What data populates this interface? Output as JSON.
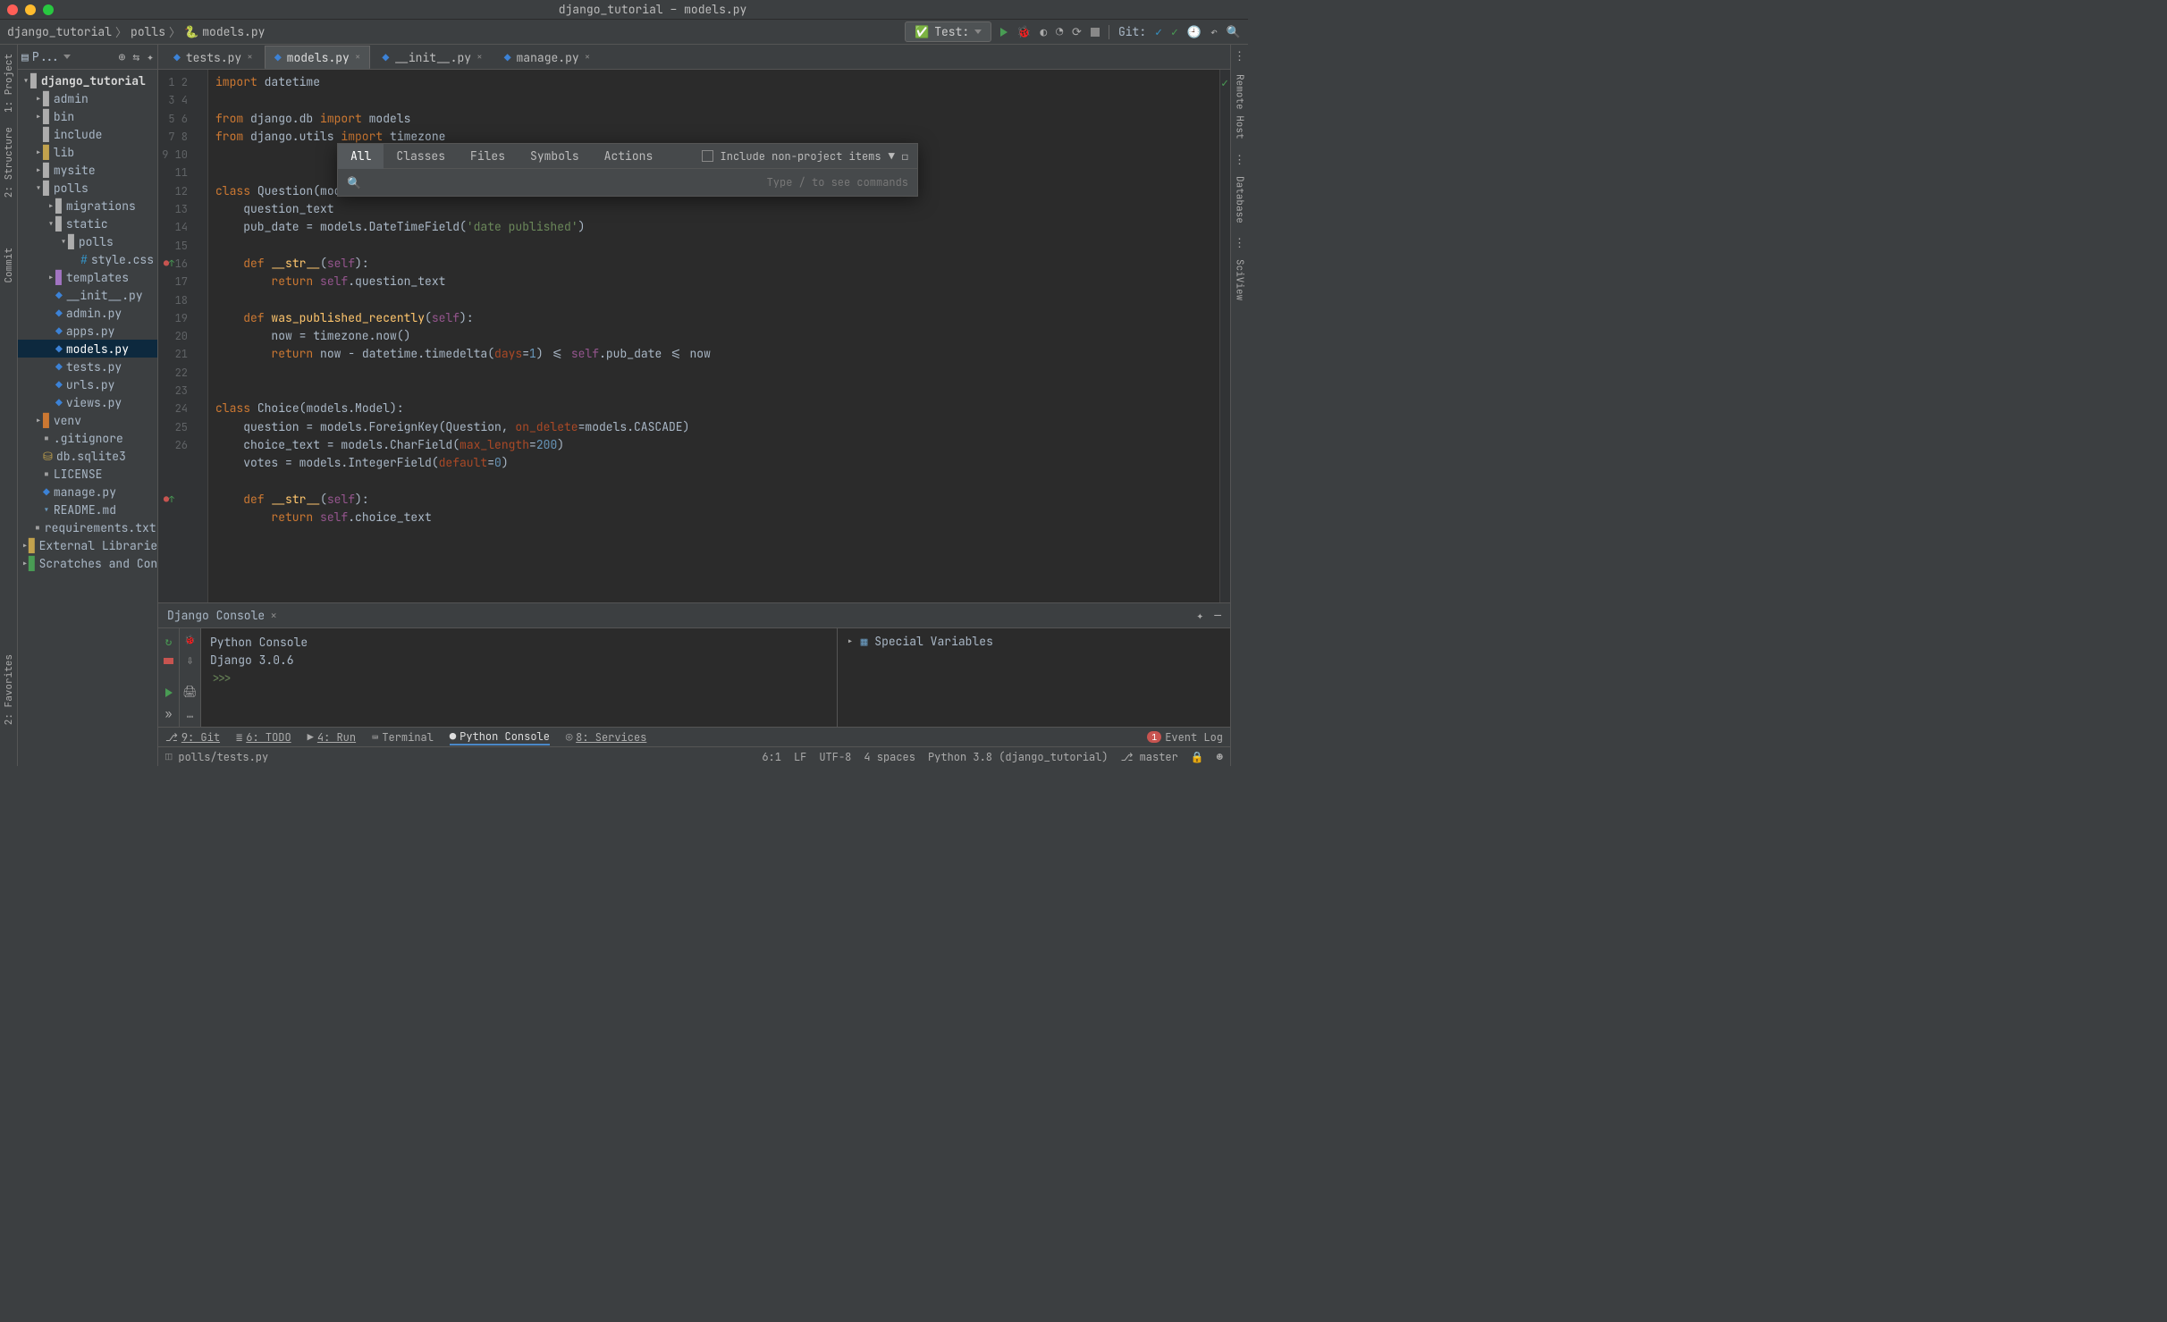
{
  "title": "django_tutorial – models.py",
  "breadcrumb": [
    "django_tutorial",
    "polls",
    "models.py"
  ],
  "run_config": "Test:",
  "git_label": "Git:",
  "left_tabs": [
    "1: Project",
    "2: Structure",
    "Commit",
    "2: Favorites"
  ],
  "right_tabs": [
    "Remote Host",
    "Database",
    "SciView"
  ],
  "project_panel_label": "P...",
  "tree": {
    "root": "django_tutorial",
    "items": [
      {
        "d": 1,
        "t": "f",
        "n": "admin",
        "car": "right"
      },
      {
        "d": 1,
        "t": "f",
        "n": "bin",
        "car": "right"
      },
      {
        "d": 1,
        "t": "f",
        "n": "include",
        "car": "blank"
      },
      {
        "d": 1,
        "t": "fy",
        "n": "lib",
        "car": "right"
      },
      {
        "d": 1,
        "t": "f",
        "n": "mysite",
        "car": "right"
      },
      {
        "d": 1,
        "t": "f",
        "n": "polls",
        "car": "down"
      },
      {
        "d": 2,
        "t": "f",
        "n": "migrations",
        "car": "right"
      },
      {
        "d": 2,
        "t": "f",
        "n": "static",
        "car": "down"
      },
      {
        "d": 3,
        "t": "f",
        "n": "polls",
        "car": "down"
      },
      {
        "d": 4,
        "t": "css",
        "n": "style.css",
        "car": "blank"
      },
      {
        "d": 2,
        "t": "fp",
        "n": "templates",
        "car": "right"
      },
      {
        "d": 2,
        "t": "py",
        "n": "__init__.py",
        "car": "blank"
      },
      {
        "d": 2,
        "t": "py",
        "n": "admin.py",
        "car": "blank"
      },
      {
        "d": 2,
        "t": "py",
        "n": "apps.py",
        "car": "blank"
      },
      {
        "d": 2,
        "t": "py",
        "n": "models.py",
        "car": "blank",
        "sel": true
      },
      {
        "d": 2,
        "t": "py",
        "n": "tests.py",
        "car": "blank"
      },
      {
        "d": 2,
        "t": "py",
        "n": "urls.py",
        "car": "blank"
      },
      {
        "d": 2,
        "t": "py",
        "n": "views.py",
        "car": "blank"
      },
      {
        "d": 1,
        "t": "fo",
        "n": "venv",
        "car": "right"
      },
      {
        "d": 1,
        "t": "file",
        "n": ".gitignore",
        "car": "blank"
      },
      {
        "d": 1,
        "t": "db",
        "n": "db.sqlite3",
        "car": "blank"
      },
      {
        "d": 1,
        "t": "file",
        "n": "LICENSE",
        "car": "blank"
      },
      {
        "d": 1,
        "t": "py",
        "n": "manage.py",
        "car": "blank"
      },
      {
        "d": 1,
        "t": "md",
        "n": "README.md",
        "car": "blank"
      },
      {
        "d": 1,
        "t": "file",
        "n": "requirements.txt",
        "car": "blank"
      }
    ],
    "ext_lib": "External Libraries",
    "scratches": "Scratches and Consoles"
  },
  "tabs": [
    {
      "n": "tests.py",
      "a": false
    },
    {
      "n": "models.py",
      "a": true
    },
    {
      "n": "__init__.py",
      "a": false
    },
    {
      "n": "manage.py",
      "a": false
    }
  ],
  "code_lines": 26,
  "search": {
    "tabs": [
      "All",
      "Classes",
      "Files",
      "Symbols",
      "Actions"
    ],
    "include": "Include non-project items",
    "hint": "Type / to see commands"
  },
  "console": {
    "title": "Django Console",
    "lines": [
      "Python Console",
      "Django 3.0.6",
      "",
      ">>>"
    ],
    "vars": "Special Variables"
  },
  "bottom_tabs": [
    "9: Git",
    "6: TODO",
    "4: Run",
    "Terminal",
    "Python Console",
    "8: Services"
  ],
  "event_log": {
    "count": "1",
    "label": "Event Log"
  },
  "status": {
    "left": "polls/tests.py",
    "right": [
      "6:1",
      "LF",
      "UTF-8",
      "4 spaces",
      "Python 3.8 (django_tutorial)",
      "master"
    ]
  }
}
